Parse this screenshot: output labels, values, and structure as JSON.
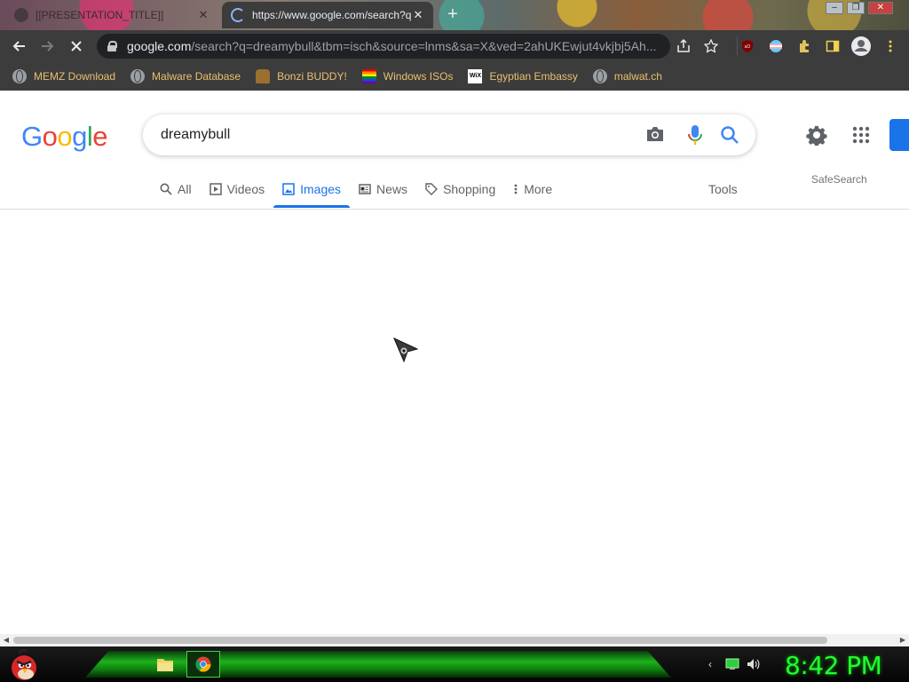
{
  "browser": {
    "tabs": [
      {
        "title": "[[PRESENTATION_TITLE]]",
        "active": false
      },
      {
        "title": "https://www.google.com/search?q=dreamybull&tbm=isch",
        "active": true
      }
    ],
    "new_tab_label": "+",
    "address": {
      "domain": "google.com",
      "path": "/search?q=dreamybull&tbm=isch&source=lnms&sa=X&ved=2ahUKEwjut4vkjbj5Ah..."
    },
    "bookmarks": [
      {
        "label": "MEMZ Download",
        "icon": "globe-icon"
      },
      {
        "label": "Malware Database",
        "icon": "globe-icon"
      },
      {
        "label": "Bonzi BUDDY!",
        "icon": "bonzi-icon"
      },
      {
        "label": "Windows ISOs",
        "icon": "rainbow-flag-icon"
      },
      {
        "label": "Egyptian Embassy",
        "icon": "wix-icon"
      },
      {
        "label": "malwat.ch",
        "icon": "globe-icon"
      }
    ]
  },
  "google": {
    "logo": [
      "G",
      "o",
      "o",
      "g",
      "l",
      "e"
    ],
    "logo_colors": [
      "#4285f4",
      "#ea4335",
      "#fbbc05",
      "#4285f4",
      "#34a853",
      "#ea4335"
    ],
    "query": "dreamybull",
    "tabs": [
      {
        "label": "All",
        "icon": "search-icon"
      },
      {
        "label": "Videos",
        "icon": "video-icon"
      },
      {
        "label": "Images",
        "icon": "image-icon",
        "active": true
      },
      {
        "label": "News",
        "icon": "news-icon"
      },
      {
        "label": "Shopping",
        "icon": "tag-icon"
      },
      {
        "label": "More",
        "icon": "more-vert-icon"
      }
    ],
    "tools_label": "Tools",
    "safesearch_label": "SafeSearch",
    "accent": "#1a73e8"
  },
  "taskbar": {
    "clock": "8:42 PM",
    "accent": "#20ff30"
  }
}
